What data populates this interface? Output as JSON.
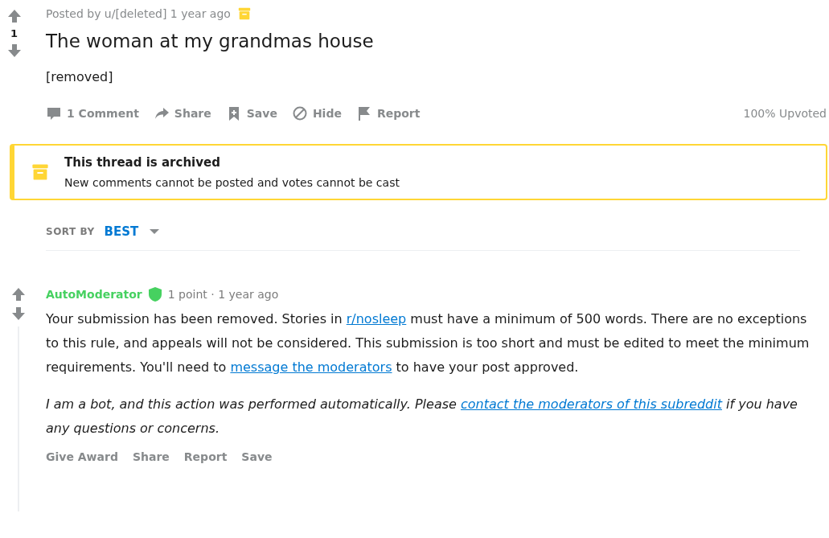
{
  "post": {
    "score": "1",
    "meta": "Posted by u/[deleted] 1 year ago",
    "archived": true,
    "title": "The woman at my grandmas house",
    "body": "[removed]",
    "actions": [
      {
        "kind": "comment",
        "label": "1 Comment"
      },
      {
        "kind": "share",
        "label": "Share"
      },
      {
        "kind": "save",
        "label": "Save"
      },
      {
        "kind": "hide",
        "label": "Hide"
      },
      {
        "kind": "report",
        "label": "Report"
      }
    ],
    "upvoted": "100% Upvoted"
  },
  "banner": {
    "title": "This thread is archived",
    "text": "New comments cannot be posted and votes cannot be cast"
  },
  "sort": {
    "label": "SORT BY",
    "value": "BEST"
  },
  "comment": {
    "author": "AutoModerator",
    "moderator": true,
    "meta": "1 point · 1 year ago",
    "paragraphs": [
      {
        "italic": false,
        "parts": [
          {
            "kind": "text",
            "text": "Your submission has been removed. Stories in "
          },
          {
            "kind": "link",
            "text": "r/nosleep"
          },
          {
            "kind": "text",
            "text": " must have a minimum of 500 words. There are no exceptions to this rule, and appeals will not be considered. This submission is too short and must be edited to meet the minimum requirements. You'll need to "
          },
          {
            "kind": "link",
            "text": "message the moderators"
          },
          {
            "kind": "text",
            "text": " to have your post approved."
          }
        ]
      },
      {
        "italic": true,
        "parts": [
          {
            "kind": "text",
            "text": "I am a bot, and this action was performed automatically. Please "
          },
          {
            "kind": "link",
            "text": "contact the moderators of this subreddit"
          },
          {
            "kind": "text",
            "text": " if you have any questions or concerns."
          }
        ]
      }
    ],
    "actions": [
      "Give Award",
      "Share",
      "Report",
      "Save"
    ]
  }
}
